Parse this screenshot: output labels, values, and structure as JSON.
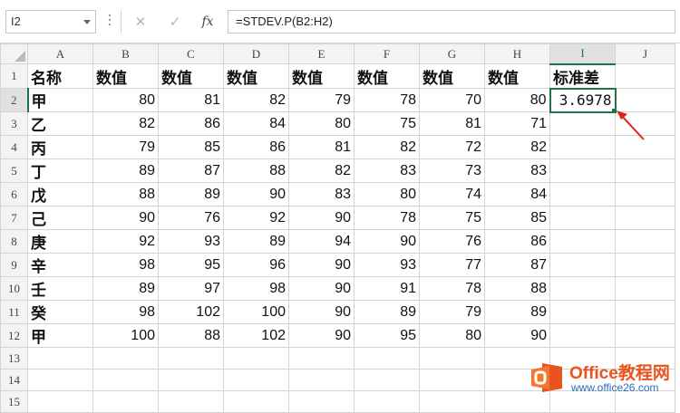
{
  "name_box": {
    "value": "I2"
  },
  "formula_bar": {
    "cancel_glyph": "✕",
    "enter_glyph": "✓",
    "fx_label": "fx",
    "formula": "=STDEV.P(B2:H2)"
  },
  "columns": [
    "A",
    "B",
    "C",
    "D",
    "E",
    "F",
    "G",
    "H",
    "I",
    "J"
  ],
  "row_numbers": [
    "1",
    "2",
    "3",
    "4",
    "5",
    "6",
    "7",
    "8",
    "9",
    "10",
    "11",
    "12",
    "13",
    "14",
    "15"
  ],
  "header_row": [
    "名称",
    "数值",
    "数值",
    "数值",
    "数值",
    "数值",
    "数值",
    "数值",
    "标准差"
  ],
  "rows": [
    {
      "name": "甲",
      "values": [
        "80",
        "81",
        "82",
        "79",
        "78",
        "70",
        "80"
      ],
      "stdev": "3.6978"
    },
    {
      "name": "乙",
      "values": [
        "82",
        "86",
        "84",
        "80",
        "75",
        "81",
        "71"
      ],
      "stdev": ""
    },
    {
      "name": "丙",
      "values": [
        "79",
        "85",
        "86",
        "81",
        "82",
        "72",
        "82"
      ],
      "stdev": ""
    },
    {
      "name": "丁",
      "values": [
        "89",
        "87",
        "88",
        "82",
        "83",
        "73",
        "83"
      ],
      "stdev": ""
    },
    {
      "name": "戊",
      "values": [
        "88",
        "89",
        "90",
        "83",
        "80",
        "74",
        "84"
      ],
      "stdev": ""
    },
    {
      "name": "己",
      "values": [
        "90",
        "76",
        "92",
        "90",
        "78",
        "75",
        "85"
      ],
      "stdev": ""
    },
    {
      "name": "庚",
      "values": [
        "92",
        "93",
        "89",
        "94",
        "90",
        "76",
        "86"
      ],
      "stdev": ""
    },
    {
      "name": "辛",
      "values": [
        "98",
        "95",
        "96",
        "90",
        "93",
        "77",
        "87"
      ],
      "stdev": ""
    },
    {
      "name": "壬",
      "values": [
        "89",
        "97",
        "98",
        "90",
        "91",
        "78",
        "88"
      ],
      "stdev": ""
    },
    {
      "name": "癸",
      "values": [
        "98",
        "102",
        "100",
        "90",
        "89",
        "79",
        "89"
      ],
      "stdev": ""
    },
    {
      "name": "甲",
      "values": [
        "100",
        "88",
        "102",
        "90",
        "95",
        "80",
        "90"
      ],
      "stdev": ""
    }
  ],
  "selected_cell": {
    "column": "I",
    "row": "2"
  },
  "watermark": {
    "title_latin": "Office",
    "title_cn": "教程网",
    "url": "www.office26.com"
  },
  "colors": {
    "excel_green": "#217346",
    "arrow_red": "#e0201b",
    "logo_orange": "#e8541e",
    "logo_blue": "#2c6fb5"
  }
}
